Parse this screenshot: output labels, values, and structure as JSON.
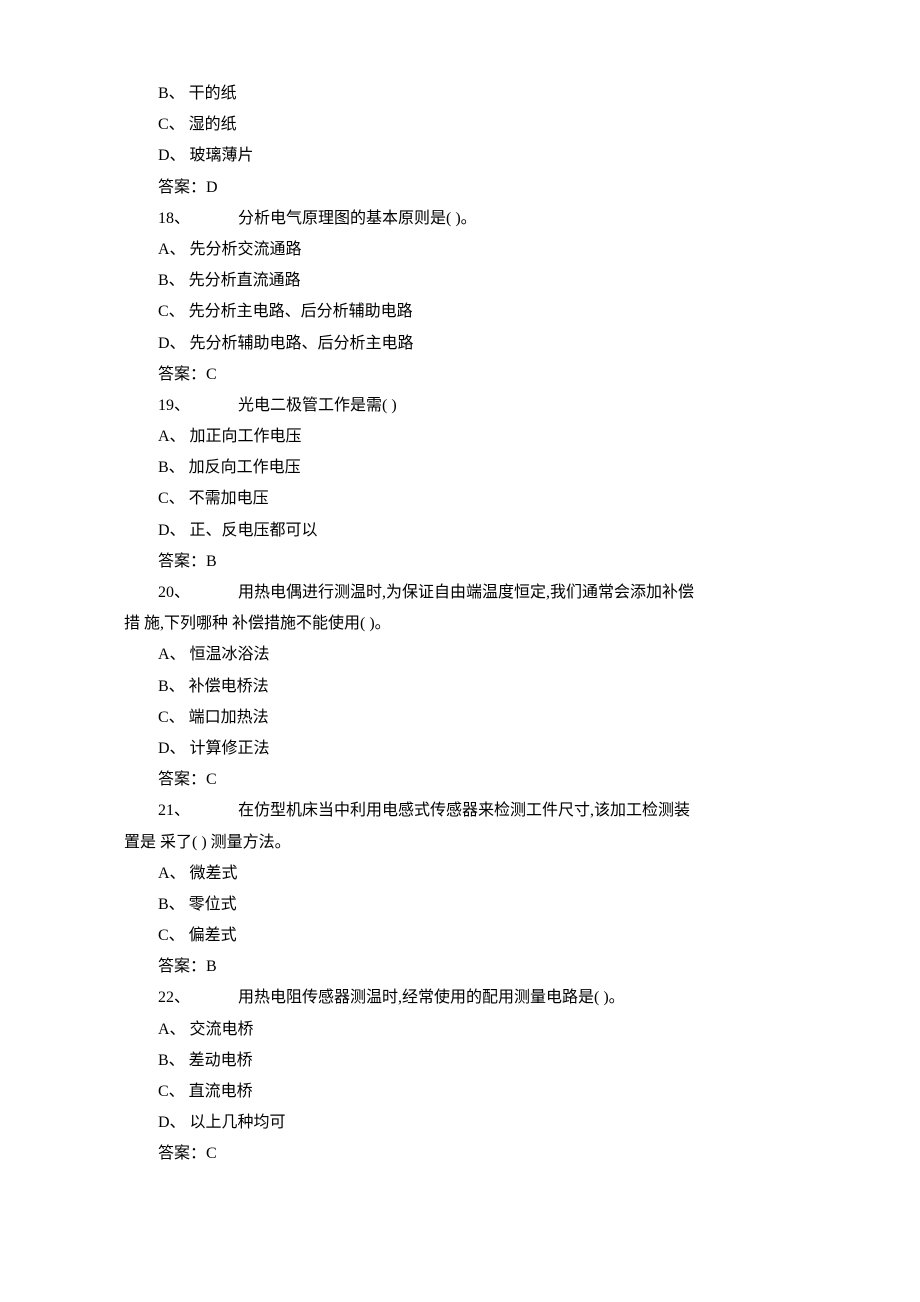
{
  "lines": [
    {
      "cls": "indent1",
      "text": "B、 干的纸"
    },
    {
      "cls": "indent1",
      "text": "C、 湿的纸"
    },
    {
      "cls": "indent1",
      "text": "D、 玻璃薄片"
    },
    {
      "cls": "indent1",
      "text": "答案：D"
    },
    {
      "cls": "indent1",
      "q": "18、",
      "stem": "分析电气原理图的基本原则是( )。"
    },
    {
      "cls": "indent1",
      "text": "A、 先分析交流通路"
    },
    {
      "cls": "indent1",
      "text": "B、 先分析直流通路"
    },
    {
      "cls": "indent1",
      "text": "C、 先分析主电路、后分析辅助电路"
    },
    {
      "cls": "indent1",
      "text": "D、 先分析辅助电路、后分析主电路"
    },
    {
      "cls": "indent1",
      "text": "答案：C"
    },
    {
      "cls": "indent1",
      "q": "19、",
      "stem": "光电二极管工作是需( )"
    },
    {
      "cls": "indent1",
      "text": "A、 加正向工作电压"
    },
    {
      "cls": "indent1",
      "text": "B、 加反向工作电压"
    },
    {
      "cls": "indent1",
      "text": "C、 不需加电压"
    },
    {
      "cls": "indent1",
      "text": "D、 正、反电压都可以"
    },
    {
      "cls": "indent1",
      "text": "答案：B"
    },
    {
      "cls": "indent1",
      "q": "20、",
      "stem": "用热电偶进行测温时,为保证自由端温度恒定,我们通常会添加补偿"
    },
    {
      "cls": "",
      "text": "措 施,下列哪种 补偿措施不能使用( )。"
    },
    {
      "cls": "indent1",
      "text": "A、 恒温冰浴法"
    },
    {
      "cls": "indent1",
      "text": "B、 补偿电桥法"
    },
    {
      "cls": "indent1",
      "text": "C、 端口加热法"
    },
    {
      "cls": "indent1",
      "text": "D、 计算修正法"
    },
    {
      "cls": "indent1",
      "text": "答案：C"
    },
    {
      "cls": "indent1",
      "q": "21、",
      "stem": "在仿型机床当中利用电感式传感器来检测工件尺寸,该加工检测装"
    },
    {
      "cls": "",
      "text": "置是 采了( ) 测量方法。"
    },
    {
      "cls": "indent1",
      "text": "A、 微差式"
    },
    {
      "cls": "indent1",
      "text": "B、 零位式"
    },
    {
      "cls": "indent1",
      "text": "C、 偏差式"
    },
    {
      "cls": "indent1",
      "text": "答案：B"
    },
    {
      "cls": "indent1",
      "q": "22、",
      "stem": "用热电阻传感器测温时,经常使用的配用测量电路是( )。"
    },
    {
      "cls": "indent1",
      "text": "A、 交流电桥"
    },
    {
      "cls": "indent1",
      "text": "B、 差动电桥"
    },
    {
      "cls": "indent1",
      "text": "C、 直流电桥"
    },
    {
      "cls": "indent1",
      "text": "D、 以上几种均可"
    },
    {
      "cls": "indent1",
      "text": "答案：C"
    }
  ]
}
